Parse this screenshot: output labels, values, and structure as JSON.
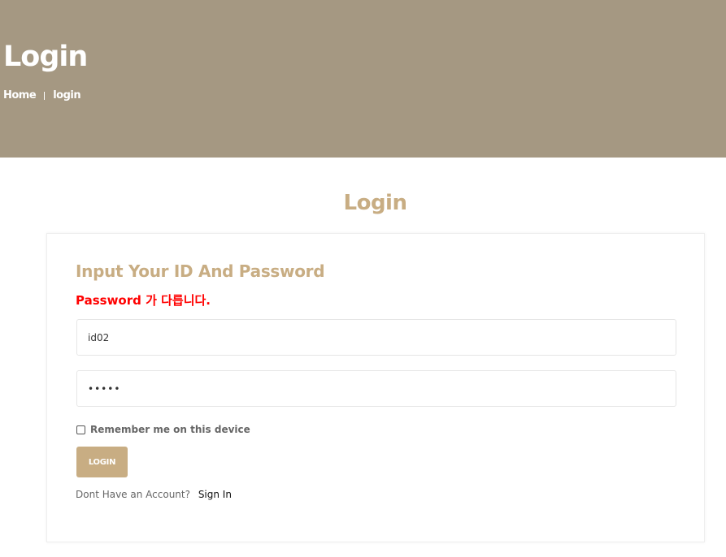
{
  "hero": {
    "title": "Login",
    "breadcrumb": {
      "home": "Home",
      "current": "login"
    },
    "background_color": "#a59882"
  },
  "section_title": "Login",
  "form": {
    "heading": "Input Your ID And Password",
    "error": "Password 가 다릅니다.",
    "id_value": "id02",
    "password_value": "•••••",
    "remember_label": "Remember me on this device",
    "remember_checked": false,
    "login_button": "LOGIN",
    "no_account_text": "Dont Have an Account?",
    "sign_in_link": "Sign In",
    "accent_color": "#c8ad83",
    "error_color": "#ff0000"
  }
}
